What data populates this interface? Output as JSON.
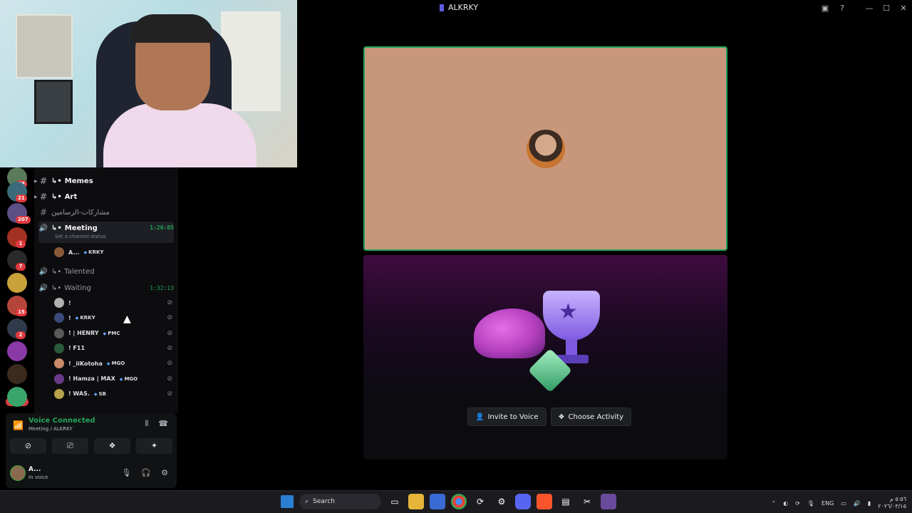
{
  "window": {
    "title": "ALKRKY"
  },
  "servers": [
    {
      "color": "#5a7a5a",
      "badge": "99"
    },
    {
      "color": "#3b6b7a",
      "badge": "21"
    },
    {
      "color": "#5b4f86",
      "badge": "207"
    },
    {
      "color": "#a33020",
      "badge": "1"
    },
    {
      "color": "#2a2a2a",
      "badge": "7"
    },
    {
      "color": "#c9a23a",
      "badge": ""
    },
    {
      "color": "#b3453a",
      "badge": "15"
    },
    {
      "color": "#2f3a4a",
      "badge": "2"
    },
    {
      "color": "#8a3aa6",
      "badge": ""
    },
    {
      "color": "#3b2a1e",
      "badge": ""
    },
    {
      "color": "#3aa56a",
      "badge": ""
    }
  ],
  "server_new_badge": "NEW",
  "channels": {
    "memes": "Memes",
    "art": "Art",
    "arabic": "مشاركات-الرسامين",
    "meeting": "Meeting",
    "meeting_timer": "1:26:05",
    "meeting_status": "Set a channel status",
    "talented": "Talented",
    "waiting": "Waiting",
    "waiting_timer": "1:32:13"
  },
  "meeting_users": [
    {
      "name": "A...",
      "tag": "KRKY",
      "color": "#8a5a3a"
    }
  ],
  "waiting_users": [
    {
      "name": "!",
      "tag": "",
      "color": "#b0b0b0"
    },
    {
      "name": "!",
      "tag": "KRKY",
      "color": "#3a4a7a"
    },
    {
      "name": "! | HENRY",
      "tag": "PMC",
      "color": "#5a5a5a"
    },
    {
      "name": "! F11",
      "tag": "",
      "color": "#2a5a3a"
    },
    {
      "name": "! _iiKotoha",
      "tag": "MGO",
      "color": "#c98a6a"
    },
    {
      "name": "! Hamza | MAX",
      "tag": "MGO",
      "color": "#6a3a8a"
    },
    {
      "name": "! WAS.",
      "tag": "SB",
      "color": "#b8a24a"
    }
  ],
  "voice": {
    "status": "Voice Connected",
    "location": "Meeting / ALKRKY"
  },
  "me": {
    "name": "A...",
    "status": "In voice"
  },
  "stage": {
    "invite_label": "Invite to Voice",
    "activity_label": "Choose Activity"
  },
  "taskbar": {
    "search": "Search",
    "lang": "ENG",
    "time": "٥:٥٦ م",
    "date": "٢٠٢٦/٠٣/١٥"
  }
}
